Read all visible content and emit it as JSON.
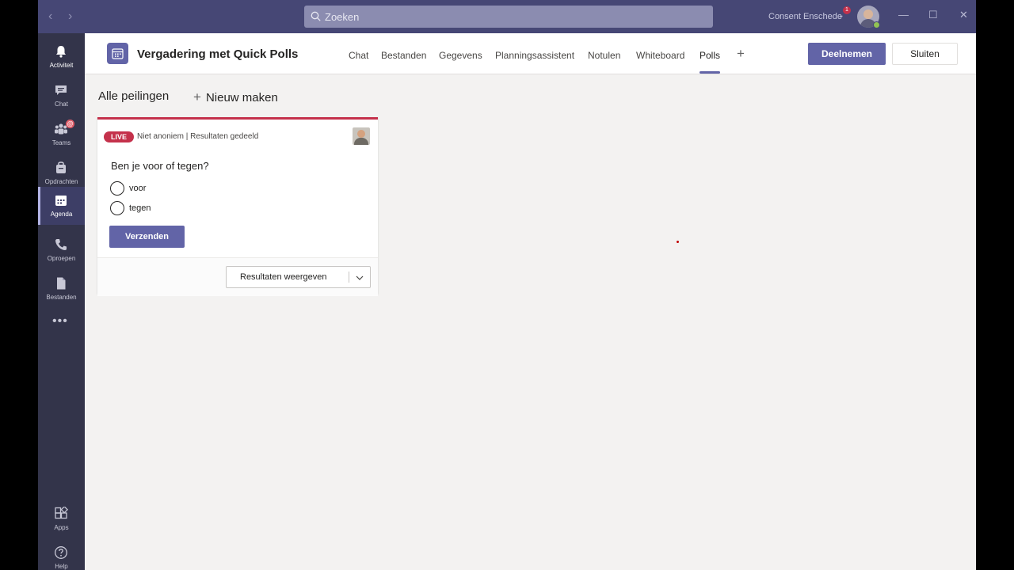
{
  "titlebar": {
    "back_arrow": "‹",
    "forward_arrow": "›",
    "search_placeholder": "Zoeken",
    "org_name": "Consent Enschede",
    "org_chevron": "⌄",
    "notification_count": "1",
    "minimize": "—",
    "maximize": "☐",
    "close": "✕"
  },
  "rail": {
    "items": [
      {
        "label": "Activiteit",
        "icon": "bell-icon",
        "active": true
      },
      {
        "label": "Chat",
        "icon": "chat-icon"
      },
      {
        "label": "Teams",
        "icon": "teams-icon",
        "badge": "@"
      },
      {
        "label": "Opdrachten",
        "icon": "assignments-icon"
      },
      {
        "label": "Agenda",
        "icon": "calendar-icon",
        "selected": true
      },
      {
        "label": "Oproepen",
        "icon": "phone-icon"
      },
      {
        "label": "Bestanden",
        "icon": "file-icon"
      }
    ],
    "more": "•••",
    "apps": "Apps",
    "help": "Help"
  },
  "header": {
    "title": "Vergadering met Quick Polls",
    "tabs": [
      "Chat",
      "Bestanden",
      "Gegevens",
      "Planningsassistent",
      "Notulen",
      "Whiteboard",
      "Polls"
    ],
    "active_tab": "Polls",
    "add_tab": "+",
    "join_label": "Deelnemen",
    "close_label": "Sluiten"
  },
  "polls": {
    "all_label": "Alle peilingen",
    "new_label": "Nieuw maken",
    "new_icon": "+",
    "card": {
      "live_badge": "LIVE",
      "meta": "Niet anoniem | Resultaten gedeeld",
      "question": "Ben je voor of tegen?",
      "options": [
        "voor",
        "tegen"
      ],
      "submit_label": "Verzenden",
      "results_label": "Resultaten weergeven"
    }
  },
  "colors": {
    "brand": "#6264a7",
    "titlebar": "#464775",
    "rail": "#33344a",
    "live": "#c4314b"
  }
}
